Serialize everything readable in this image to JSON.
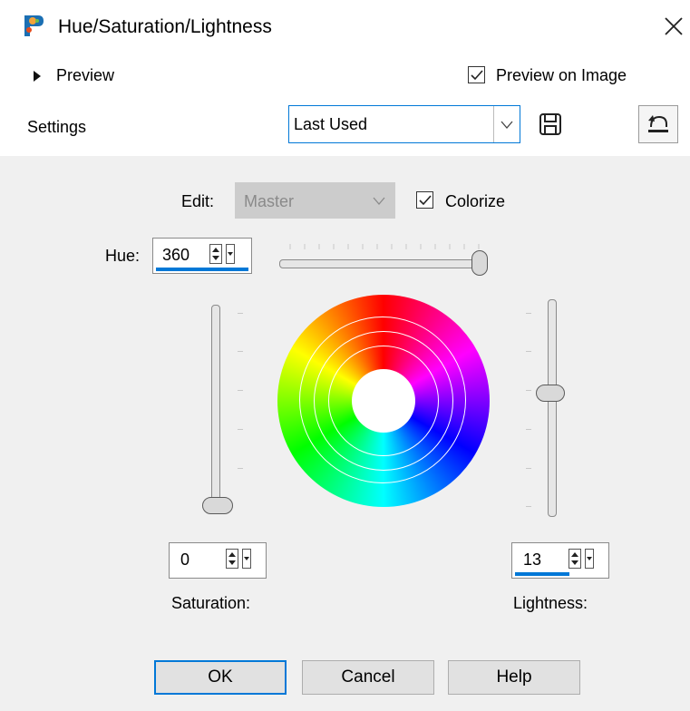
{
  "window": {
    "title": "Hue/Saturation/Lightness"
  },
  "preview_section": {
    "label": "Preview"
  },
  "preview_on_image": {
    "label": "Preview on Image",
    "checked": true
  },
  "settings": {
    "label": "Settings",
    "preset_value": "Last Used"
  },
  "edit": {
    "label": "Edit:",
    "value": "Master"
  },
  "colorize": {
    "label": "Colorize",
    "checked": true
  },
  "hue": {
    "label": "Hue:",
    "value": "360"
  },
  "saturation": {
    "label": "Saturation:",
    "value": "0"
  },
  "lightness": {
    "label": "Lightness:",
    "value": "13"
  },
  "buttons": {
    "ok": "OK",
    "cancel": "Cancel",
    "help": "Help"
  },
  "colors": {
    "accent": "#0078d7",
    "panel_bg": "#f0f0f0",
    "button_bg": "#e1e1e1"
  }
}
